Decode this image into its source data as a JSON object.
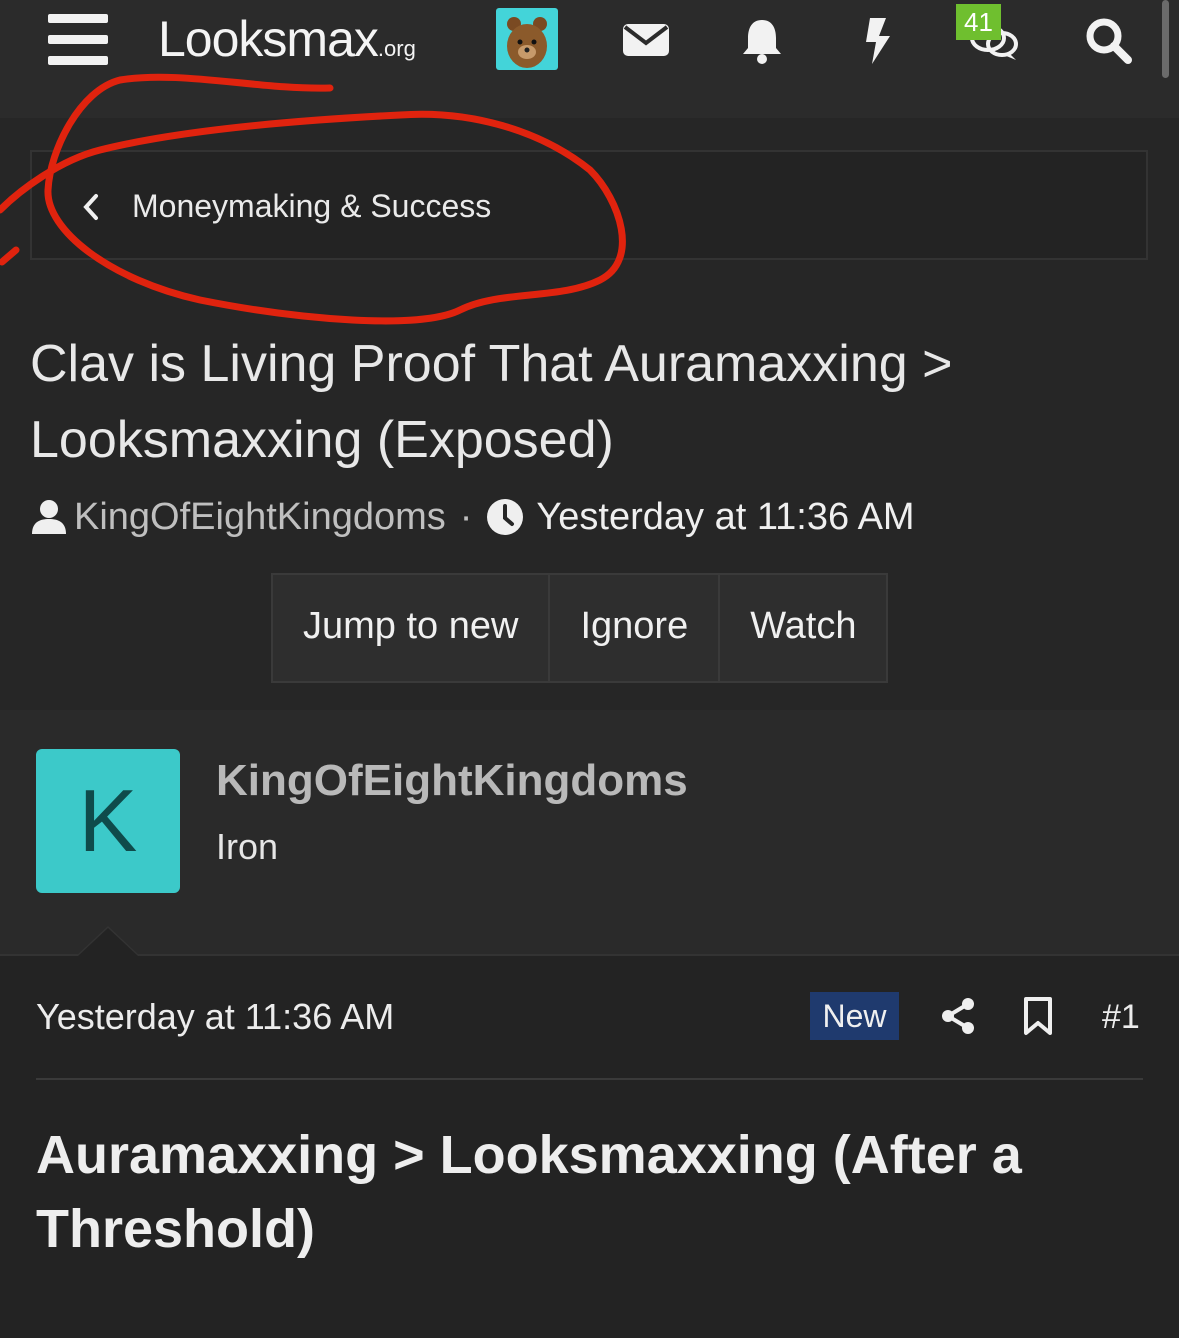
{
  "header": {
    "logo_text": "Looksmax",
    "logo_suffix": ".org",
    "notification_badge": "41",
    "icons": [
      "menu-icon",
      "user-avatar-icon",
      "mail-icon",
      "bell-icon",
      "lightning-icon",
      "chat-icon",
      "search-icon"
    ]
  },
  "breadcrumb": {
    "label": "Moneymaking & Success"
  },
  "thread": {
    "title": "Clav is Living Proof That Auramaxxing > Looksmaxxing (Exposed)",
    "author": "KingOfEightKingdoms",
    "time": "Yesterday at 11:36 AM",
    "actions": [
      "Jump to new",
      "Ignore",
      "Watch"
    ]
  },
  "post": {
    "avatar_letter": "K",
    "author": "KingOfEightKingdoms",
    "rank": "Iron",
    "time": "Yesterday at 11:36 AM",
    "badge": "New",
    "number": "#1",
    "heading": "Auramaxxing > Looksmaxxing (After a Threshold)"
  },
  "colors": {
    "accent_avatar": "#3cc9c9",
    "badge_new": "#1f3a6e",
    "badge_count": "#6fbf2f",
    "annotation": "#e0230e"
  }
}
